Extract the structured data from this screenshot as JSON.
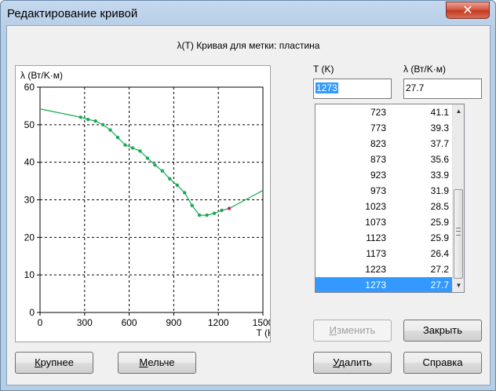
{
  "window": {
    "title": "Редактирование кривой",
    "close_label": "✕"
  },
  "heading": "λ(T) Кривая для метки: пластина",
  "fields": {
    "t_label": "T (K)",
    "lambda_label": "λ (Вт/K·м)",
    "t_value": "1273",
    "lambda_value": "27.7"
  },
  "table": {
    "rows": [
      {
        "t": "723",
        "l": "41.1"
      },
      {
        "t": "773",
        "l": "39.3"
      },
      {
        "t": "823",
        "l": "37.7"
      },
      {
        "t": "873",
        "l": "35.6"
      },
      {
        "t": "923",
        "l": "33.9"
      },
      {
        "t": "973",
        "l": "31.9"
      },
      {
        "t": "1023",
        "l": "28.5"
      },
      {
        "t": "1073",
        "l": "25.9"
      },
      {
        "t": "1123",
        "l": "25.9"
      },
      {
        "t": "1173",
        "l": "26.4"
      },
      {
        "t": "1223",
        "l": "27.2"
      },
      {
        "t": "1273",
        "l": "27.7"
      }
    ],
    "selected_index": 11
  },
  "buttons": {
    "change_first": "И",
    "change_rest": "зменить",
    "close": "Закрыть",
    "larger_first": "К",
    "larger_rest": "рупнее",
    "smaller_first": "М",
    "smaller_rest": "ельче",
    "delete_first": "У",
    "delete_rest": "далить",
    "help": "Справка"
  },
  "colors": {
    "curve": "#1aaa55",
    "point": "#1aaa55",
    "selected_point": "#cc2255",
    "selection": "#3399ff"
  },
  "chart_data": {
    "type": "line",
    "ylabel": "λ (Вт/K·м)",
    "xlabel": "T (K)",
    "xlim": [
      0,
      1500
    ],
    "ylim": [
      0,
      60
    ],
    "xticks": [
      0,
      300,
      600,
      900,
      1200,
      1500
    ],
    "yticks": [
      0,
      10,
      20,
      30,
      40,
      50,
      60
    ],
    "grid": true,
    "curve_start": [
      0,
      54.2
    ],
    "curve_end": [
      1500,
      32.5
    ],
    "points": [
      [
        273,
        52.0
      ],
      [
        323,
        51.4
      ],
      [
        373,
        51.0
      ],
      [
        423,
        50.0
      ],
      [
        473,
        48.6
      ],
      [
        523,
        46.6
      ],
      [
        573,
        44.6
      ],
      [
        623,
        43.8
      ],
      [
        673,
        43.0
      ],
      [
        723,
        41.1
      ],
      [
        773,
        39.3
      ],
      [
        823,
        37.7
      ],
      [
        873,
        35.6
      ],
      [
        923,
        33.9
      ],
      [
        973,
        31.9
      ],
      [
        1023,
        28.5
      ],
      [
        1073,
        25.9
      ],
      [
        1123,
        25.9
      ],
      [
        1173,
        26.4
      ],
      [
        1223,
        27.2
      ],
      [
        1273,
        27.7
      ]
    ],
    "selected_point_index": 20
  }
}
